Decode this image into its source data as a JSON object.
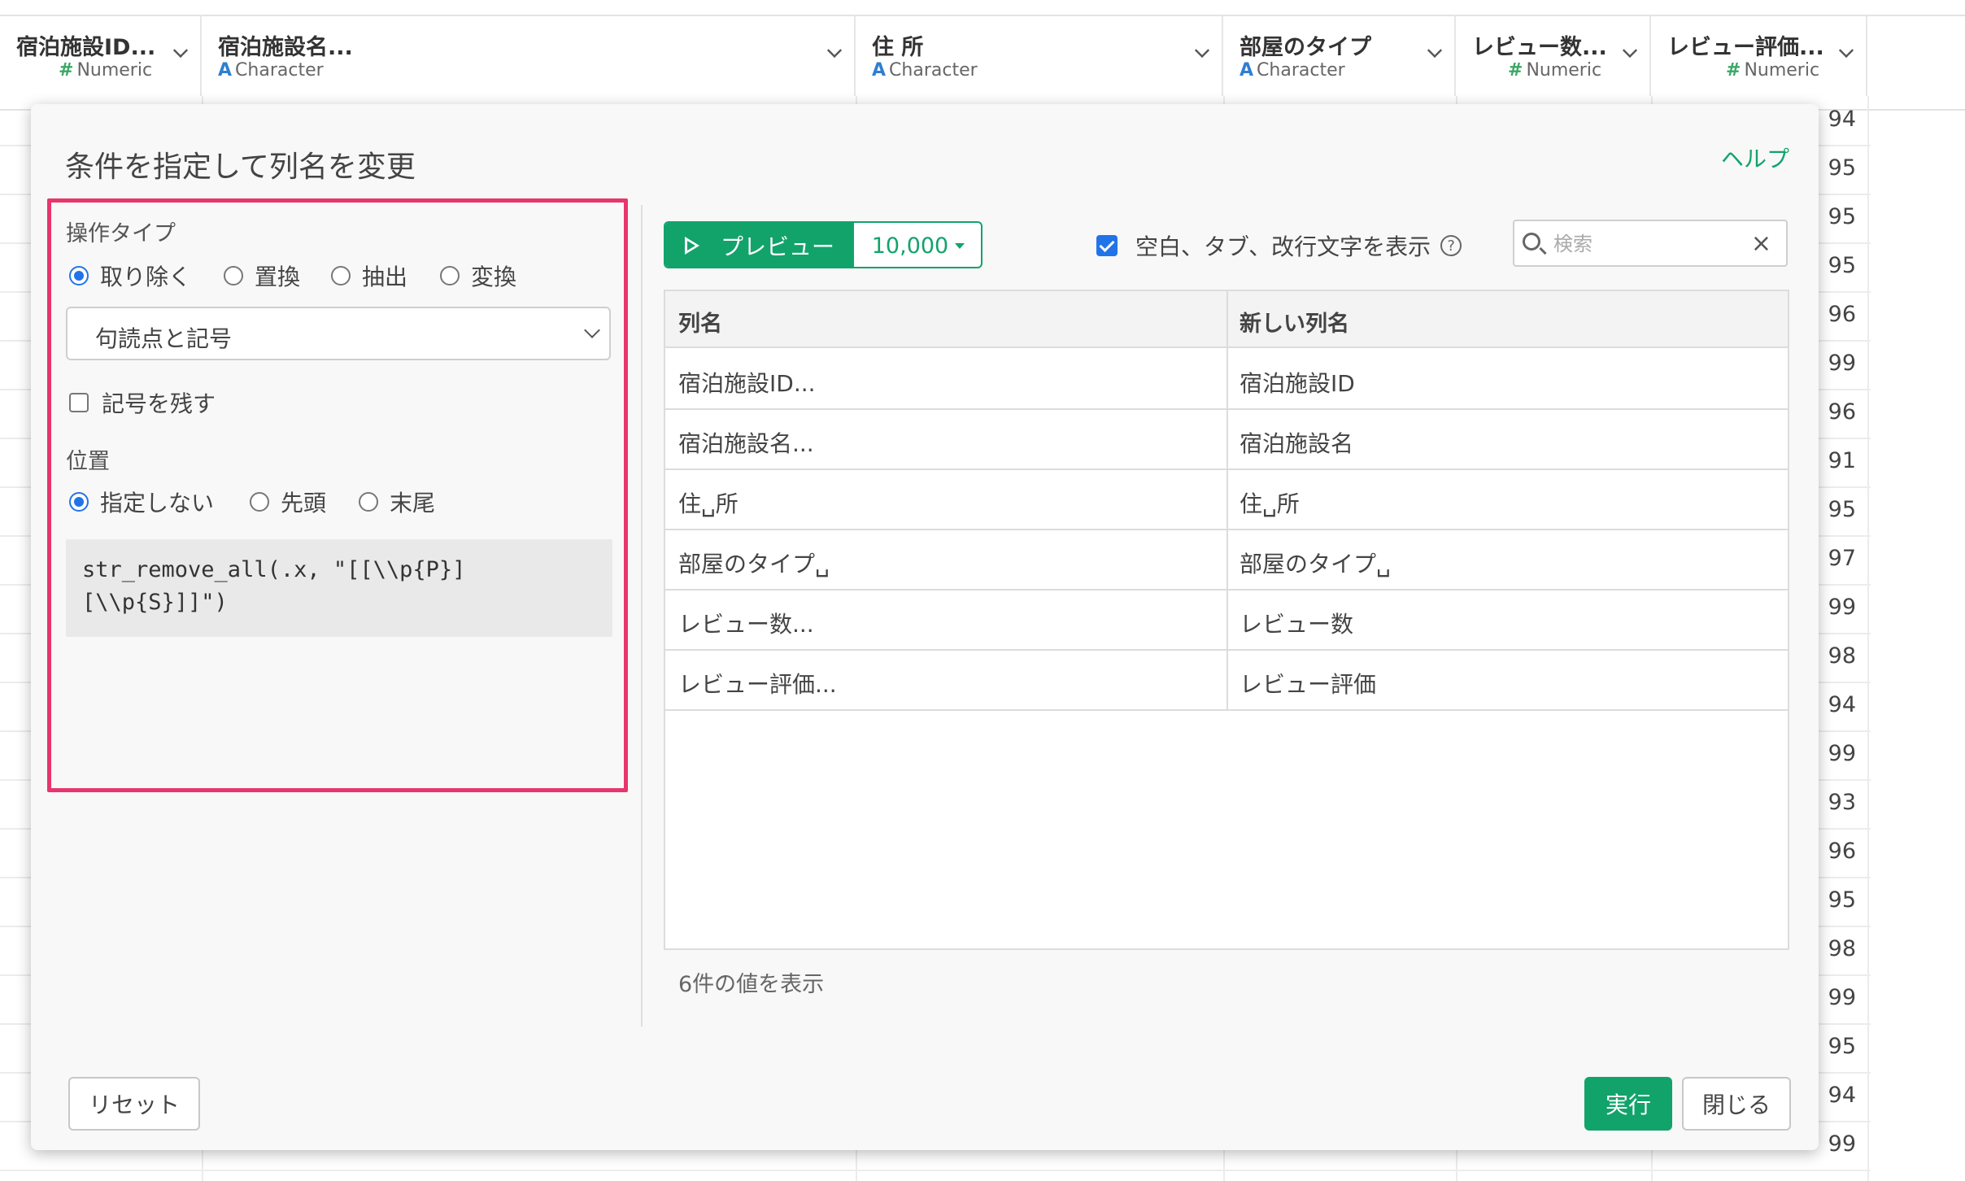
{
  "columns": [
    {
      "name": "宿泊施設ID...",
      "type_mark": "#",
      "type": "Numeric"
    },
    {
      "name": "宿泊施設名...",
      "type_mark": "A",
      "type": "Character"
    },
    {
      "name": "住 所",
      "type_mark": "A",
      "type": "Character"
    },
    {
      "name": "部屋のタイプ",
      "type_mark": "A",
      "type": "Character"
    },
    {
      "name": "レビュー数...",
      "type_mark": "#",
      "type": "Numeric"
    },
    {
      "name": "レビュー評価...",
      "type_mark": "#",
      "type": "Numeric"
    }
  ],
  "right_values": [
    "94",
    "95",
    "95",
    "95",
    "96",
    "99",
    "96",
    "91",
    "95",
    "97",
    "99",
    "98",
    "94",
    "99",
    "93",
    "96",
    "95",
    "98",
    "99",
    "95",
    "94",
    "99"
  ],
  "dialog": {
    "title": "条件を指定して列名を変更",
    "help": "ヘルプ",
    "operation": {
      "label": "操作タイプ",
      "options": [
        "取り除く",
        "置換",
        "抽出",
        "変換"
      ],
      "selected": "取り除く"
    },
    "target_select": {
      "value": "句読点と記号"
    },
    "keep_symbol": {
      "label": "記号を残す",
      "checked": false
    },
    "position": {
      "label": "位置",
      "options": [
        "指定しない",
        "先頭",
        "末尾"
      ],
      "selected": "指定しない"
    },
    "code": "str_remove_all(.x, \"[[\\\\p{P}]\n[\\\\p{S}]]\")",
    "preview": {
      "label": "プレビュー",
      "count": "10,000"
    },
    "show_whitespace": {
      "label": "空白、タブ、改行文字を表示",
      "checked": true,
      "help_icon": "?"
    },
    "search": {
      "placeholder": "検索",
      "value": ""
    },
    "table": {
      "headers": [
        "列名",
        "新しい列名"
      ],
      "rows": [
        [
          "宿泊施設ID...",
          "宿泊施設ID"
        ],
        [
          "宿泊施設名...",
          "宿泊施設名"
        ],
        [
          "住␣所",
          "住␣所"
        ],
        [
          "部屋のタイプ␣",
          "部屋のタイプ␣"
        ],
        [
          "レビュー数...",
          "レビュー数"
        ],
        [
          "レビュー評価...",
          "レビュー評価"
        ]
      ]
    },
    "count_text": "6件の値を表示",
    "buttons": {
      "reset": "リセット",
      "run": "実行",
      "close": "閉じる"
    }
  },
  "colors": {
    "accent": "#12a36b",
    "highlight_border": "#e8356d",
    "radio_blue": "#2174e8"
  }
}
